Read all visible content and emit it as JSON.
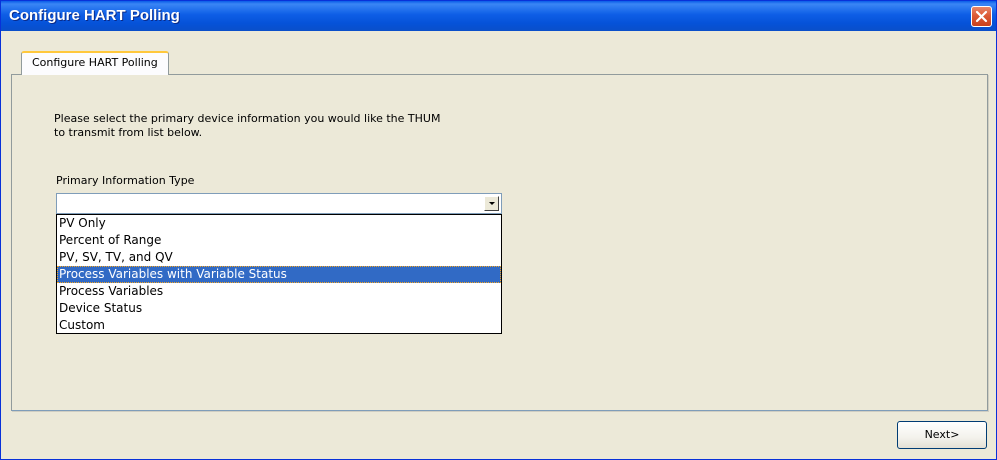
{
  "window": {
    "title": "Configure HART Polling",
    "close_icon": "close-icon"
  },
  "tabs": [
    {
      "label": "Configure HART Polling",
      "active": true
    }
  ],
  "instructions": {
    "line1": "Please select the primary device information you would like the THUM",
    "line2": "to transmit from list below."
  },
  "primary_info": {
    "label": "Primary Information Type",
    "value": "",
    "options": [
      "PV Only",
      "Percent of Range",
      "PV, SV, TV, and QV",
      "Process Variables with Variable Status",
      "Process Variables",
      "Device Status",
      "Custom"
    ],
    "highlighted_index": 3
  },
  "buttons": {
    "next_label": "Next>"
  },
  "colors": {
    "titlebar": "#0A5CE8",
    "selection": "#316AC5",
    "background": "#ECE9D8",
    "close_button": "#DC5A36"
  }
}
